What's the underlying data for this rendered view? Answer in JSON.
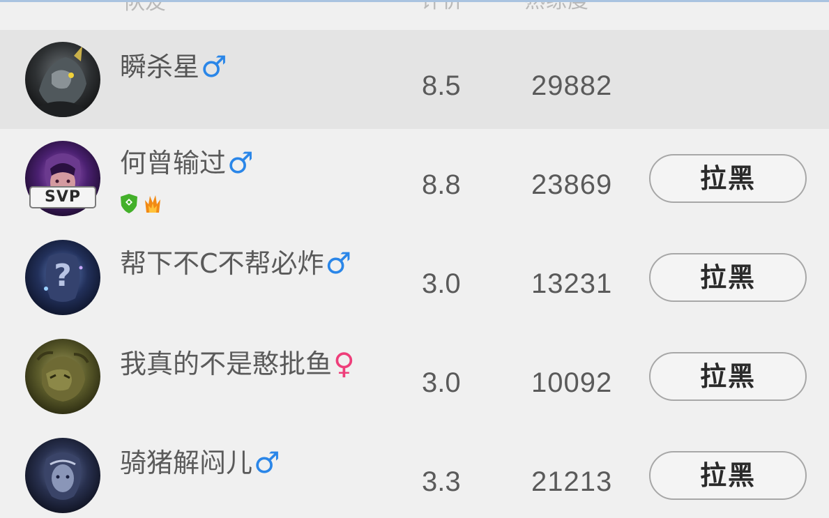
{
  "header": {
    "col_name": "队友",
    "col_score": "评价",
    "col_heat": "熟练度"
  },
  "players": [
    {
      "name": "瞬杀星",
      "gender": "male",
      "gender_symbol": "♂",
      "score": "8.5",
      "heat": "29882",
      "selected": true,
      "svp": false,
      "button_label": ""
    },
    {
      "name": "何曾输过",
      "gender": "male",
      "gender_symbol": "♂",
      "score": "8.8",
      "heat": "23869",
      "selected": false,
      "svp": true,
      "svp_label": "SVP",
      "honors": [
        "green-shield-icon",
        "flame-icon"
      ],
      "button_label": "拉黑"
    },
    {
      "name": "帮下不C不帮必炸",
      "gender": "male",
      "gender_symbol": "♂",
      "score": "3.0",
      "heat": "13231",
      "selected": false,
      "svp": false,
      "button_label": "拉黑"
    },
    {
      "name": "我真的不是憨批鱼",
      "gender": "female",
      "gender_symbol": "♀",
      "score": "3.0",
      "heat": "10092",
      "selected": false,
      "svp": false,
      "button_label": "拉黑"
    },
    {
      "name": "骑猪解闷儿",
      "gender": "male",
      "gender_symbol": "♂",
      "score": "3.3",
      "heat": "21213",
      "selected": false,
      "svp": false,
      "button_label": "拉黑"
    }
  ],
  "colors": {
    "male": "#2a86e8",
    "female": "#ee3e7a",
    "selected_row": "#e4e4e4",
    "background": "#f0f0f0"
  }
}
